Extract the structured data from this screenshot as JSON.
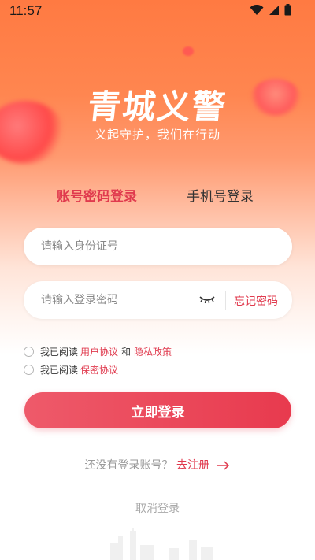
{
  "status_bar": {
    "time": "11:57",
    "icons": [
      "wifi-icon",
      "signal-icon",
      "battery-icon"
    ]
  },
  "brand": {
    "title": "青城义警",
    "slogan": "义起守护，我们在行动"
  },
  "tabs": [
    {
      "label": "账号密码登录",
      "active": true
    },
    {
      "label": "手机号登录",
      "active": false
    }
  ],
  "form": {
    "id_placeholder": "请输入身份证号",
    "password_placeholder": "请输入登录密码",
    "forgot_label": "忘记密码",
    "eye_icon": "eye-closed-icon"
  },
  "agreements": [
    {
      "prefix": "我已阅读",
      "link1": "用户协议",
      "conj": "和",
      "link2": "隐私政策",
      "checked": false
    },
    {
      "prefix": "我已阅读",
      "link1": "保密协议",
      "checked": false
    }
  ],
  "login_button": "立即登录",
  "register": {
    "question": "还没有登录账号？",
    "link": "去注册",
    "arrow_icon": "arrow-right-icon"
  },
  "cancel_label": "取消登录",
  "colors": {
    "accent": "#e03a4e",
    "button": "#e83a4e",
    "header_gradient_top": "#ff7a42"
  }
}
